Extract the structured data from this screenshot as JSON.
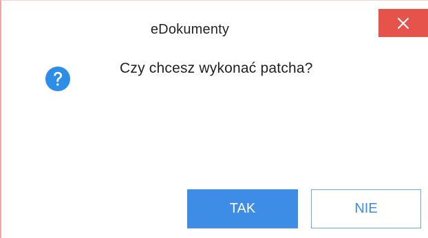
{
  "dialog": {
    "title": "eDokumenty",
    "message": "Czy chcesz wykonać patcha?",
    "icon": "question-icon",
    "close_icon": "close-icon",
    "buttons": {
      "yes_label": "TAK",
      "no_label": "NIE"
    }
  },
  "colors": {
    "accent": "#3d8ce6",
    "close_button": "#e5534b",
    "question_icon": "#2d8ee8"
  }
}
